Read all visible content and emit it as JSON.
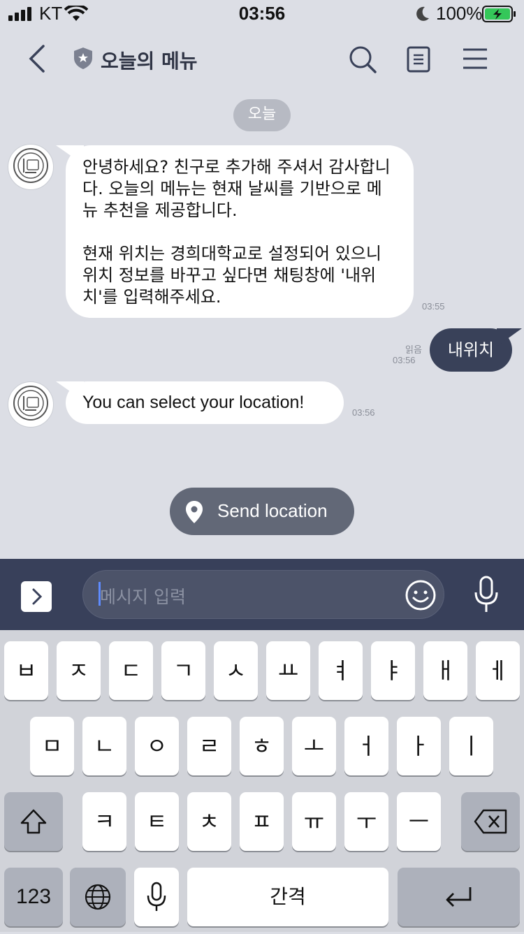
{
  "status_bar": {
    "carrier": "KT",
    "time": "03:56",
    "battery": "100%"
  },
  "header": {
    "title": "오늘의 메뉴"
  },
  "chat": {
    "date_label": "오늘",
    "messages": [
      {
        "from": "bot",
        "lines": [
          "안녕하세요? 친구로 추가해 주셔서 감사합니",
          "다. 오늘의 메뉴는 현재 날씨를 기반으로 메",
          "뉴 추천을 제공합니다.",
          "",
          "현재 위치는 경희대학교로 설정되어 있으니",
          "위치 정보를 바꾸고 싶다면 채팅창에 '내위",
          "치'를 입력해주세요."
        ],
        "time": "03:55"
      },
      {
        "from": "me",
        "text": "내위치",
        "read": "읽음",
        "time": "03:56"
      },
      {
        "from": "bot",
        "text": "You can select your location!",
        "time": "03:56"
      }
    ],
    "quick_reply": "Send location"
  },
  "input": {
    "placeholder": "메시지 입력"
  },
  "keyboard": {
    "row1": [
      "ㅂ",
      "ㅈ",
      "ㄷ",
      "ㄱ",
      "ㅅ",
      "ㅛ",
      "ㅕ",
      "ㅑ",
      "ㅐ",
      "ㅔ"
    ],
    "row2": [
      "ㅁ",
      "ㄴ",
      "ㅇ",
      "ㄹ",
      "ㅎ",
      "ㅗ",
      "ㅓ",
      "ㅏ",
      "ㅣ"
    ],
    "row3": [
      "ㅋ",
      "ㅌ",
      "ㅊ",
      "ㅍ",
      "ㅠ",
      "ㅜ",
      "ㅡ"
    ],
    "numbers_key": "123",
    "space_key": "간격"
  },
  "colors": {
    "background": "#dcdee5",
    "outgoing_bubble": "#394159",
    "input_bar": "#38405a",
    "battery_green": "#34c759"
  },
  "icons": [
    "back-chevron-icon",
    "official-shield-icon",
    "search-icon",
    "notes-icon",
    "menu-icon",
    "restaurant-avatar-icon",
    "location-pin-icon",
    "expand-chevron-icon",
    "emoji-icon",
    "microphone-icon",
    "shift-icon",
    "backspace-icon",
    "globe-icon",
    "return-icon"
  ]
}
